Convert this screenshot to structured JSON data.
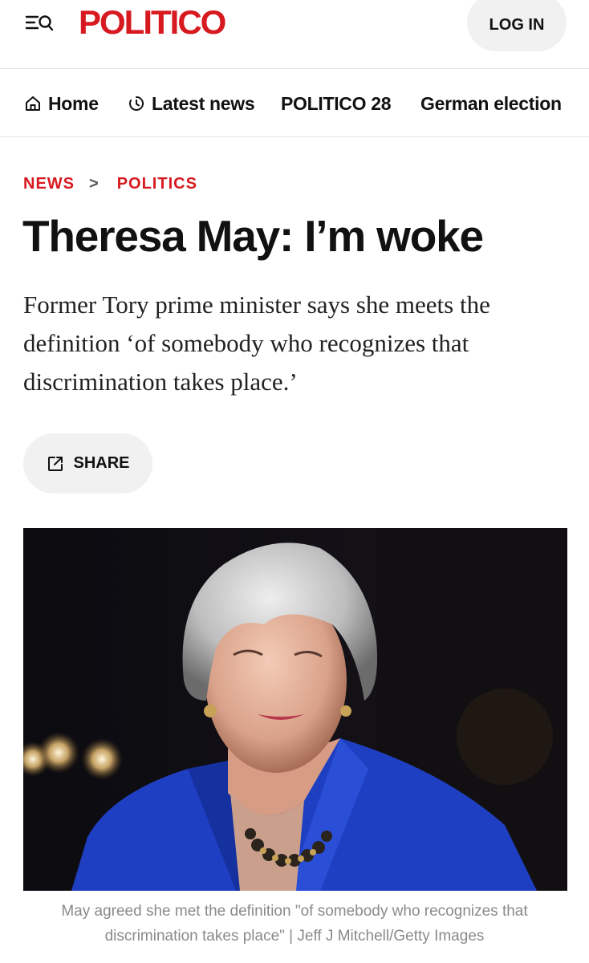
{
  "header": {
    "logo_text": "POLITICO",
    "login_label": "LOG IN",
    "menu_icon": "menu-search-icon"
  },
  "nav": {
    "items": [
      {
        "label": "Home",
        "icon": "home-icon"
      },
      {
        "label": "Latest news",
        "icon": "clock-icon"
      },
      {
        "label": "POLITICO 28"
      },
      {
        "label": "German election"
      }
    ]
  },
  "breadcrumb": {
    "section": "NEWS",
    "separator": ">",
    "subsection": "POLITICS"
  },
  "article": {
    "headline": "Theresa May: I’m woke",
    "dek": "Former Tory prime minister says she meets the definition ‘of somebody who recognizes that discrimination takes place.’",
    "share_label": "SHARE",
    "photo_caption": "May agreed she met the definition \"of somebody who recognizes that discrimination takes place\" | Jeff J Mitchell/Getty Images"
  },
  "colors": {
    "brand_red": "#d71920",
    "pill_bg": "#f1f1f1",
    "jacket_blue": "#1f3fc2"
  }
}
